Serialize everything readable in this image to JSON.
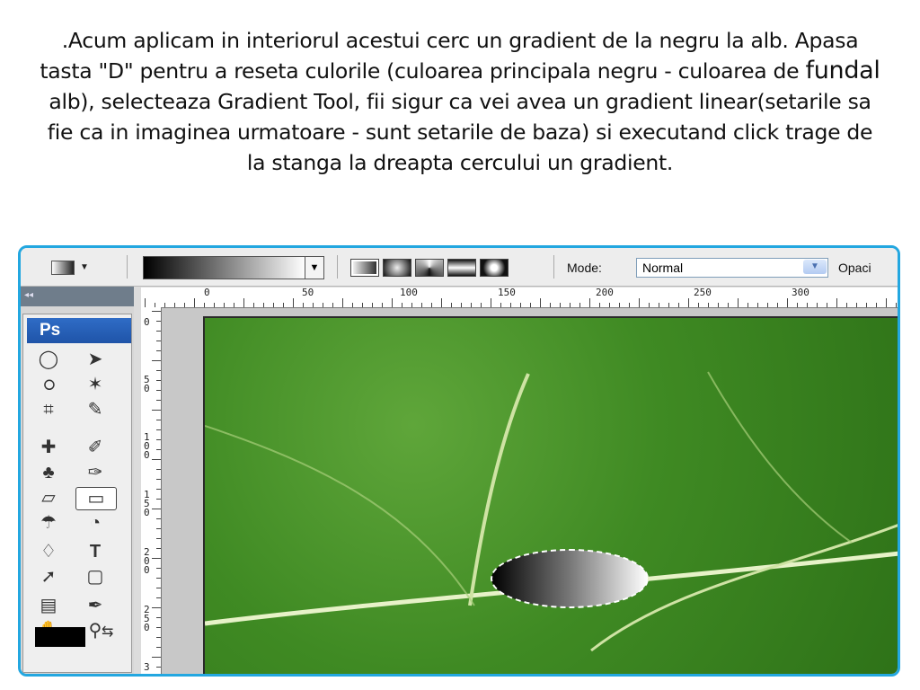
{
  "instructions": {
    "part1": ".Acum aplicam in interiorul acestui cerc un gradient de la negru la alb. Apasa tasta \"D\" pentru a reseta culorile (culoarea principala negru - culoarea de ",
    "emphasis": "fundal",
    "part2": " alb), selecteaza Gradient Tool, fii sigur ca vei avea un gradient linear(setarile sa fie ca in imaginea urmatoare - sunt setarile de baza) si executand click trage de la stanga la dreapta cercului un gradient."
  },
  "options_bar": {
    "mode_label": "Mode:",
    "mode_value": "Normal",
    "opacity_label": "Opaci"
  },
  "toolbox": {
    "collapse_glyph": "◂◂",
    "logo": "Ps"
  },
  "rulers": {
    "top": [
      "0",
      "50",
      "100",
      "150",
      "200",
      "250",
      "300"
    ],
    "left": [
      "0",
      "50",
      "100",
      "150",
      "200",
      "250",
      "3"
    ]
  },
  "icons": {
    "tools": [
      "marquee-icon",
      "move-icon",
      "lasso-icon",
      "magic-wand-icon",
      "crop-icon",
      "slice-icon",
      "healing-brush-icon",
      "brush-icon",
      "clone-stamp-icon",
      "history-brush-icon",
      "eraser-icon",
      "gradient-icon",
      "blur-icon",
      "dodge-icon",
      "pen-icon",
      "type-icon",
      "path-selection-icon",
      "shape-icon",
      "notes-icon",
      "eyedropper-icon",
      "hand-icon",
      "zoom-icon"
    ]
  },
  "colors": {
    "frame": "#23a7e0",
    "foreground": "#000000",
    "background": "#ffffff"
  }
}
